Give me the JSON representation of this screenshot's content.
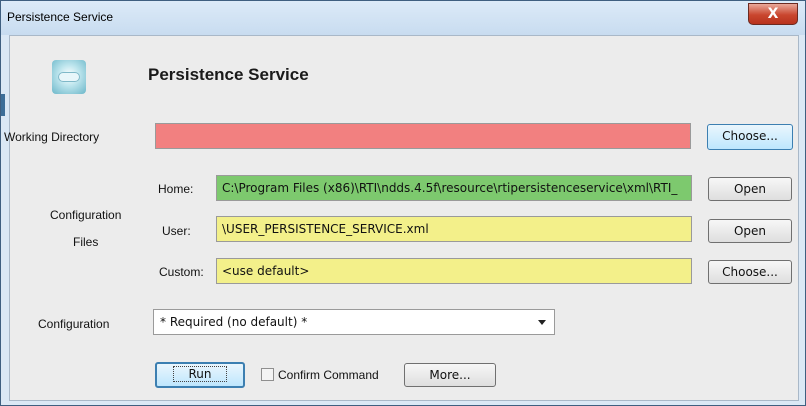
{
  "window": {
    "title": "Persistence Service",
    "close_symbol": "X"
  },
  "header": {
    "title": "Persistence Service",
    "icon": "cloud-icon"
  },
  "working_directory": {
    "label": "Working Directory",
    "value": "",
    "button": "Choose...",
    "status_color": "#f28080"
  },
  "configuration_files": {
    "group_label_line1": "Configuration",
    "group_label_line2": "Files",
    "home": {
      "label": "Home:",
      "value": "C:\\Program Files (x86)\\RTI\\ndds.4.5f\\resource\\rtipersistenceservice\\xml\\RTI_",
      "button": "Open",
      "color": "#7dc96e"
    },
    "user": {
      "label": "User:",
      "value": "\\USER_PERSISTENCE_SERVICE.xml",
      "button": "Open",
      "color": "#f3f08a"
    },
    "custom": {
      "label": "Custom:",
      "value": "<use default>",
      "button": "Choose...",
      "color": "#f3f08a"
    }
  },
  "configuration": {
    "label": "Configuration",
    "selected": "* Required (no default) *"
  },
  "actions": {
    "run": "Run",
    "confirm_label": "Confirm Command",
    "confirm_checked": false,
    "more": "More..."
  }
}
